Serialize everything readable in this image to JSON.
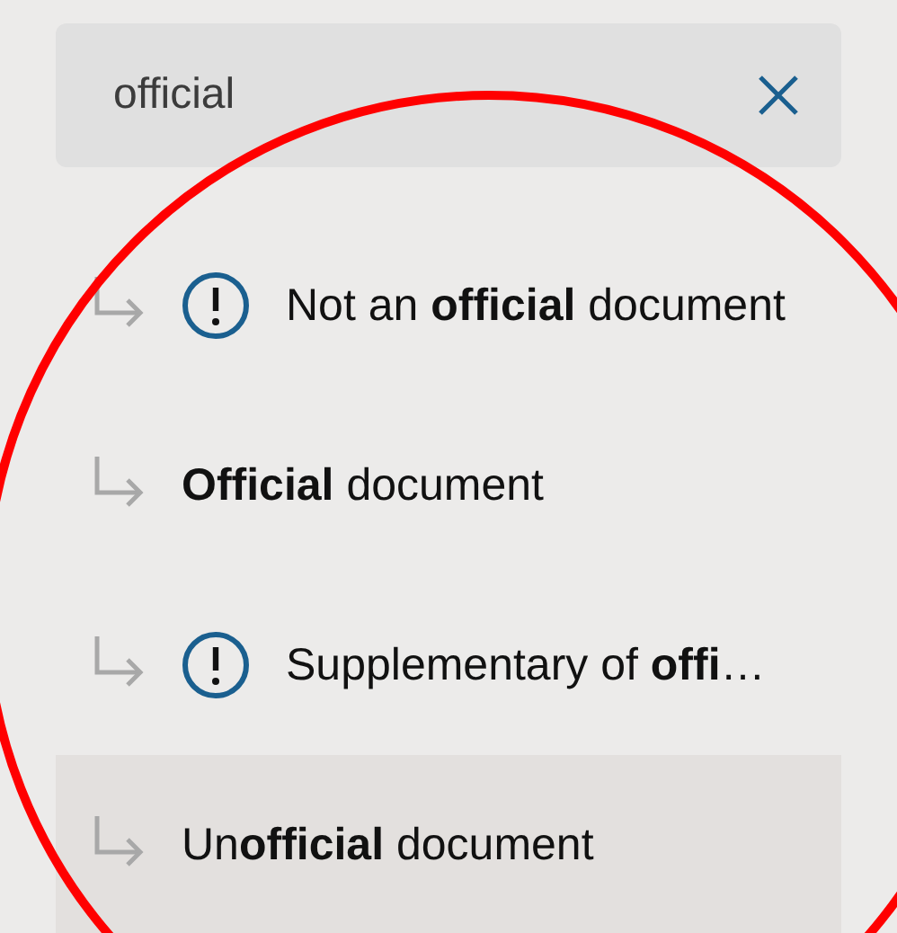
{
  "search": {
    "value": "official"
  },
  "results": [
    {
      "label": "Not an **official** document",
      "warning": true,
      "selected": false
    },
    {
      "label": "**Official** document",
      "warning": false,
      "selected": false
    },
    {
      "label": "Supplementary of **offi**…",
      "warning": true,
      "selected": false
    },
    {
      "label": "Un**official** document",
      "warning": false,
      "selected": true
    }
  ]
}
